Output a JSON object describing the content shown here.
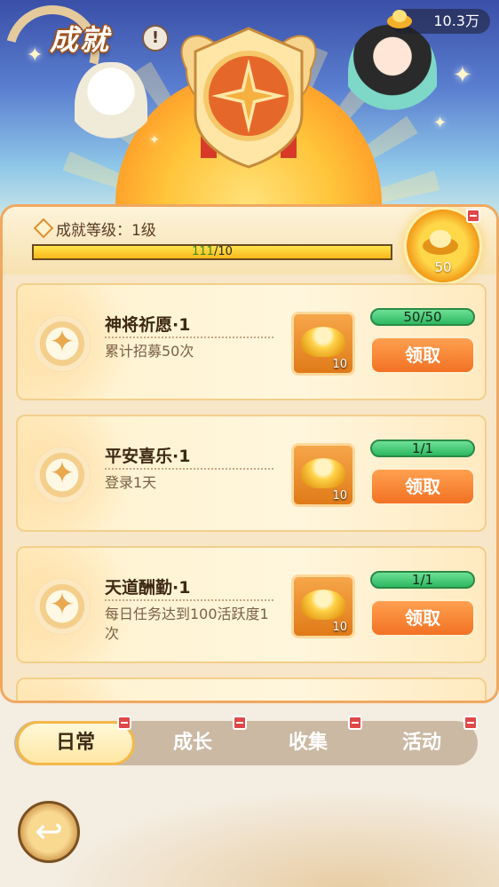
{
  "header": {
    "title": "成就",
    "info_icon": "exclamation-icon",
    "currency": {
      "amount": "10.3万",
      "icon": "gold-ingot-icon"
    }
  },
  "level": {
    "label": "成就等级：1级",
    "progress_current": "111",
    "progress_rest": "/10",
    "progress_fraction": 1.0,
    "reward_count": "50"
  },
  "achievements": [
    {
      "name": "神将祈愿·1",
      "desc": "累计招募50次",
      "reward_qty": "10",
      "progress": "50/50",
      "button": "领取"
    },
    {
      "name": "平安喜乐·1",
      "desc": "登录1天",
      "reward_qty": "10",
      "progress": "1/1",
      "button": "领取"
    },
    {
      "name": "天道酬勤·1",
      "desc": "每日任务达到100活跃度1次",
      "reward_qty": "10",
      "progress": "1/1",
      "button": "领取"
    }
  ],
  "tabs": [
    {
      "label": "日常",
      "active": true
    },
    {
      "label": "成长",
      "active": false
    },
    {
      "label": "收集",
      "active": false
    },
    {
      "label": "活动",
      "active": false
    }
  ],
  "colors": {
    "accent": "#f27224",
    "progress_green": "#2db860",
    "panel_border": "#f0a860"
  }
}
